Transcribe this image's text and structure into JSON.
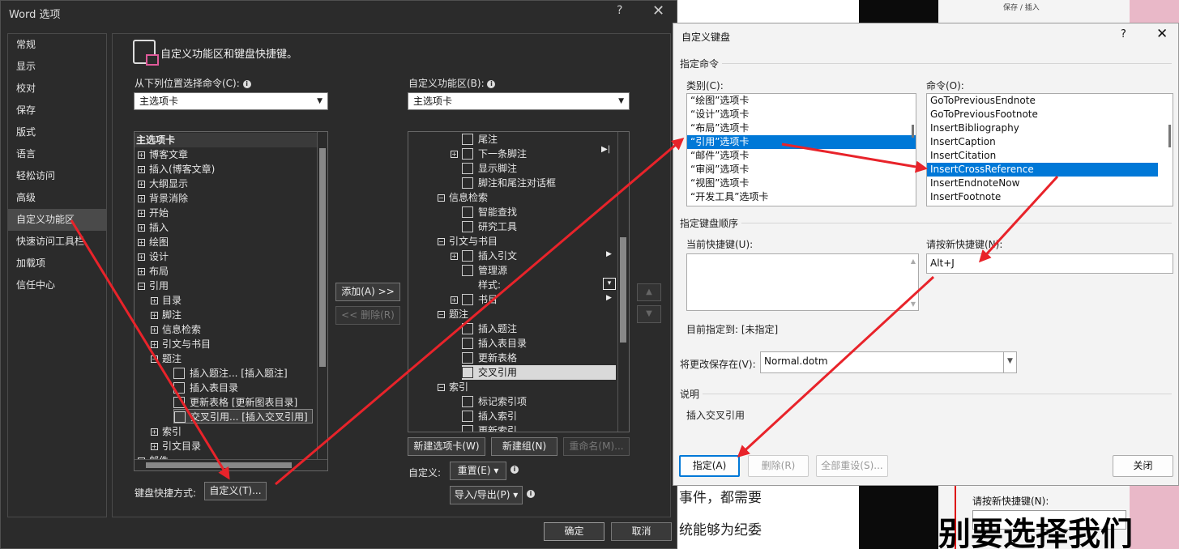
{
  "background": {
    "snippet_top": "保存 / 插入",
    "snippet_label": "请按新快捷键(N):",
    "snippet_big": "别要选择我们",
    "text_line1": "事件，都需要",
    "text_line2": "统能够为纪委"
  },
  "word_options": {
    "title": "Word 选项",
    "help": "?",
    "close": "✕",
    "nav": [
      "常规",
      "显示",
      "校对",
      "保存",
      "版式",
      "语言",
      "轻松访问",
      "高级",
      "自定义功能区",
      "快速访问工具栏",
      "加载项",
      "信任中心"
    ],
    "header": "自定义功能区和键盘快捷键。",
    "left_label": "从下列位置选择命令(C):",
    "left_select": "主选项卡",
    "right_label": "自定义功能区(B):",
    "right_select": "主选项卡",
    "left_tree": {
      "header": "主选项卡",
      "items": [
        "博客文章",
        "插入(博客文章)",
        "大纲显示",
        "背景消除",
        "开始",
        "插入",
        "绘图",
        "设计",
        "布局",
        "引用",
        "目录",
        "脚注",
        "信息检索",
        "引文与书目",
        "题注",
        "插入题注... [插入题注]",
        "插入表目录",
        "更新表格 [更新图表目录]",
        "交叉引用... [插入交叉引用]",
        "索引",
        "引文目录",
        "邮件"
      ]
    },
    "right_tree": {
      "items": [
        "尾注",
        "下一条脚注",
        "显示脚注",
        "脚注和尾注对话框",
        "信息检索",
        "智能查找",
        "研究工具",
        "引文与书目",
        "插入引文",
        "管理源",
        "样式:",
        "书目",
        "题注",
        "插入题注",
        "插入表目录",
        "更新表格",
        "交叉引用",
        "索引",
        "标记索引项",
        "插入索引",
        "更新索引"
      ]
    },
    "add_button": "添加(A) >>",
    "remove_button": "<< 删除(R)",
    "new_tab_button": "新建选项卡(W)",
    "new_group_button": "新建组(N)",
    "rename_button": "重命名(M)...",
    "customize_label": "自定义:",
    "reset_button": "重置(E) ▾",
    "import_export_button": "导入/导出(P) ▾",
    "keyboard_label": "键盘快捷方式:",
    "keyboard_button": "自定义(T)...",
    "ok_button": "确定",
    "cancel_button": "取消"
  },
  "custom_keyboard": {
    "title": "自定义键盘",
    "help": "?",
    "close": "✕",
    "section_command": "指定命令",
    "category_label": "类别(C):",
    "categories": [
      "“绘图”选项卡",
      "“设计”选项卡",
      "“布局”选项卡",
      "“引用”选项卡",
      "“邮件”选项卡",
      "“审阅”选项卡",
      "“视图”选项卡",
      "“开发工具”选项卡"
    ],
    "selected_category": "“引用”选项卡",
    "command_label": "命令(O):",
    "commands": [
      "GoToPreviousEndnote",
      "GoToPreviousFootnote",
      "InsertBibliography",
      "InsertCaption",
      "InsertCitation",
      "InsertCrossReference",
      "InsertEndnoteNow",
      "InsertFootnote"
    ],
    "selected_command": "InsertCrossReference",
    "section_keys": "指定键盘顺序",
    "current_keys_label": "当前快捷键(U):",
    "new_key_label": "请按新快捷键(N):",
    "new_key_value": "Alt+J",
    "assigned_to_label": "目前指定到:",
    "assigned_to_value": "[未指定]",
    "save_in_label": "将更改保存在(V):",
    "save_in_value": "Normal.dotm",
    "section_desc": "说明",
    "description": "插入交叉引用",
    "assign_button": "指定(A)",
    "remove_button": "删除(R)",
    "reset_all_button": "全部重设(S)...",
    "close_button": "关闭"
  },
  "colors": {
    "dark_bg": "#2b2b2b",
    "accent_blue": "#0078d7",
    "annotation_red": "#e8232a"
  }
}
